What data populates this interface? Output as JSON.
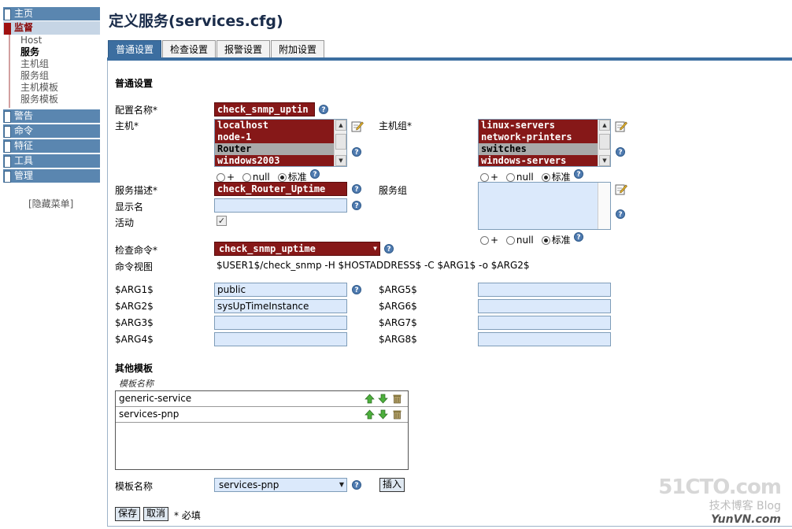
{
  "sidebar": {
    "heads": [
      "主页",
      "监督",
      "警告",
      "命令",
      "特征",
      "工具",
      "管理"
    ],
    "monitor_items": [
      "Host",
      "服务",
      "主机组",
      "服务组",
      "主机模板",
      "服务模板"
    ],
    "hide_menu": "[隐藏菜单]"
  },
  "page": {
    "title": "定义服务(services.cfg)"
  },
  "tabs": [
    "普通设置",
    "检查设置",
    "报警设置",
    "附加设置"
  ],
  "form": {
    "section_general": "普通设置",
    "config_name_label": "配置名称*",
    "config_name_value": "check_snmp_uptin",
    "host_label": "主机*",
    "hosts": [
      "localhost",
      "node-1",
      "Router",
      "windows2003"
    ],
    "selected_host": "Router",
    "hostgroup_label": "主机组*",
    "hostgroups": [
      "linux-servers",
      "network-printers",
      "switches",
      "windows-servers"
    ],
    "selected_hostgroup": "switches",
    "radio_plus": "+",
    "radio_null": "null",
    "radio_std": "标准",
    "service_desc_label": "服务描述*",
    "service_desc_value": "check_Router_Uptime",
    "servicegroup_label": "服务组",
    "display_name_label": "显示名",
    "display_name_value": "",
    "active_label": "活动",
    "active_checked": "✓",
    "check_cmd_label": "检查命令*",
    "check_cmd_value": "check_snmp_uptime",
    "cmd_view_label": "命令视图",
    "cmd_view_value": "$USER1$/check_snmp -H $HOSTADDRESS$ -C $ARG1$ -o $ARG2$",
    "args": [
      {
        "label": "$ARG1$",
        "value": "public"
      },
      {
        "label": "$ARG2$",
        "value": "sysUpTimeInstance"
      },
      {
        "label": "$ARG3$",
        "value": ""
      },
      {
        "label": "$ARG4$",
        "value": ""
      },
      {
        "label": "$ARG5$",
        "value": ""
      },
      {
        "label": "$ARG6$",
        "value": ""
      },
      {
        "label": "$ARG7$",
        "value": ""
      },
      {
        "label": "$ARG8$",
        "value": ""
      }
    ],
    "section_templates": "其他模板",
    "templates_header": "模板名称",
    "templates": [
      "generic-service",
      "services-pnp"
    ],
    "template_name_label": "模板名称",
    "template_select": "services-pnp",
    "insert_btn": "插入",
    "save_btn": "保存",
    "cancel_btn": "取消",
    "required_note": "* 必填"
  },
  "watermark": {
    "line1": "51CTO.com",
    "line2": "技术博客  Blog",
    "line3": "YunVN.com"
  },
  "colors": {
    "nav": "#5a86b0",
    "tab_active": "#3c6ea0",
    "dark_field": "#861818",
    "light_field": "#dbe9fb"
  }
}
